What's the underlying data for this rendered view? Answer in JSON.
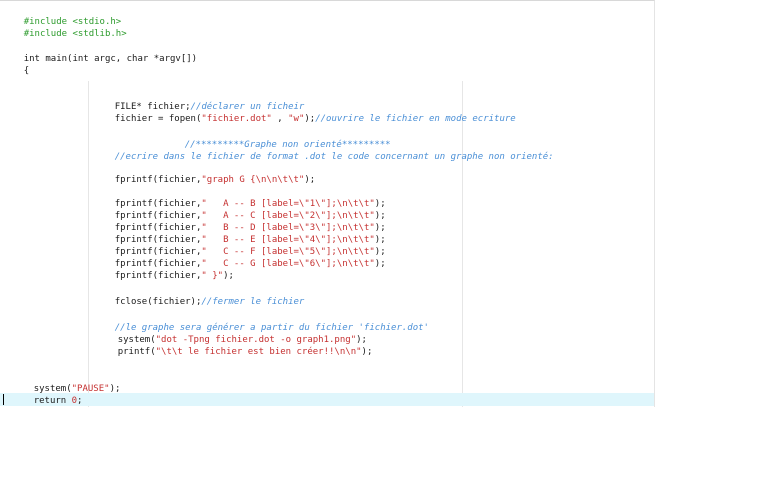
{
  "editor": {
    "code": {
      "l1": "#include <stdio.h>",
      "l2": "#include <stdlib.h>",
      "l3": "int main(int argc, char *argv[])",
      "l4": "{",
      "l5a": "FILE* fichier;",
      "l5b": "//déclarer un ficheir",
      "l6a": "fichier = fopen(",
      "l6b": "\"fichier.dot\"",
      "l6c": " , ",
      "l6d": "\"w\"",
      "l6e": ");",
      "l6f": "//ouvrire le fichier en mode ecriture",
      "l7": "//*********Graphe non orienté*********",
      "l8": "//ecrire dans le fichier de format .dot le code concernant un graphe non orienté:",
      "l9a": "fprintf(fichier,",
      "l9b": "\"graph G {\\n\\n\\t\\t\"",
      "l9c": ");",
      "e1a": "fprintf(fichier,",
      "e1b": "\"   A -- B [label=\\\"1\\\"];\\n\\t\\t\"",
      "e1c": ");",
      "e2a": "fprintf(fichier,",
      "e2b": "\"   A -- C [label=\\\"2\\\"];\\n\\t\\t\"",
      "e2c": ");",
      "e3a": "fprintf(fichier,",
      "e3b": "\"   B -- D [label=\\\"3\\\"];\\n\\t\\t\"",
      "e3c": ");",
      "e4a": "fprintf(fichier,",
      "e4b": "\"   B -- E [label=\\\"4\\\"];\\n\\t\\t\"",
      "e4c": ");",
      "e5a": "fprintf(fichier,",
      "e5b": "\"   C -- F [label=\\\"5\\\"];\\n\\t\\t\"",
      "e5c": ");",
      "e6a": "fprintf(fichier,",
      "e6b": "\"   C -- G [label=\\\"6\\\"];\\n\\t\\t\"",
      "e6c": ");",
      "e7a": "fprintf(fichier,",
      "e7b": "\" }\"",
      "e7c": ");",
      "c1a": "fclose(fichier);",
      "c1b": "//fermer le fichier",
      "g1": "//le graphe sera générer a partir du fichier 'fichier.dot'",
      "g2a": "system(",
      "g2b": "\"dot -Tpng fichier.dot -o graph1.png\"",
      "g2c": ");",
      "g3a": "printf(",
      "g3b": "\"\\t\\t le fichier est bien créer!!\\n\\n\"",
      "g3c": ");",
      "p1a": "system(",
      "p1b": "\"PAUSE\"",
      "p1c": ");",
      "r1a": "return ",
      "r1b": "0",
      "r1c": ";",
      "end": "}"
    }
  }
}
